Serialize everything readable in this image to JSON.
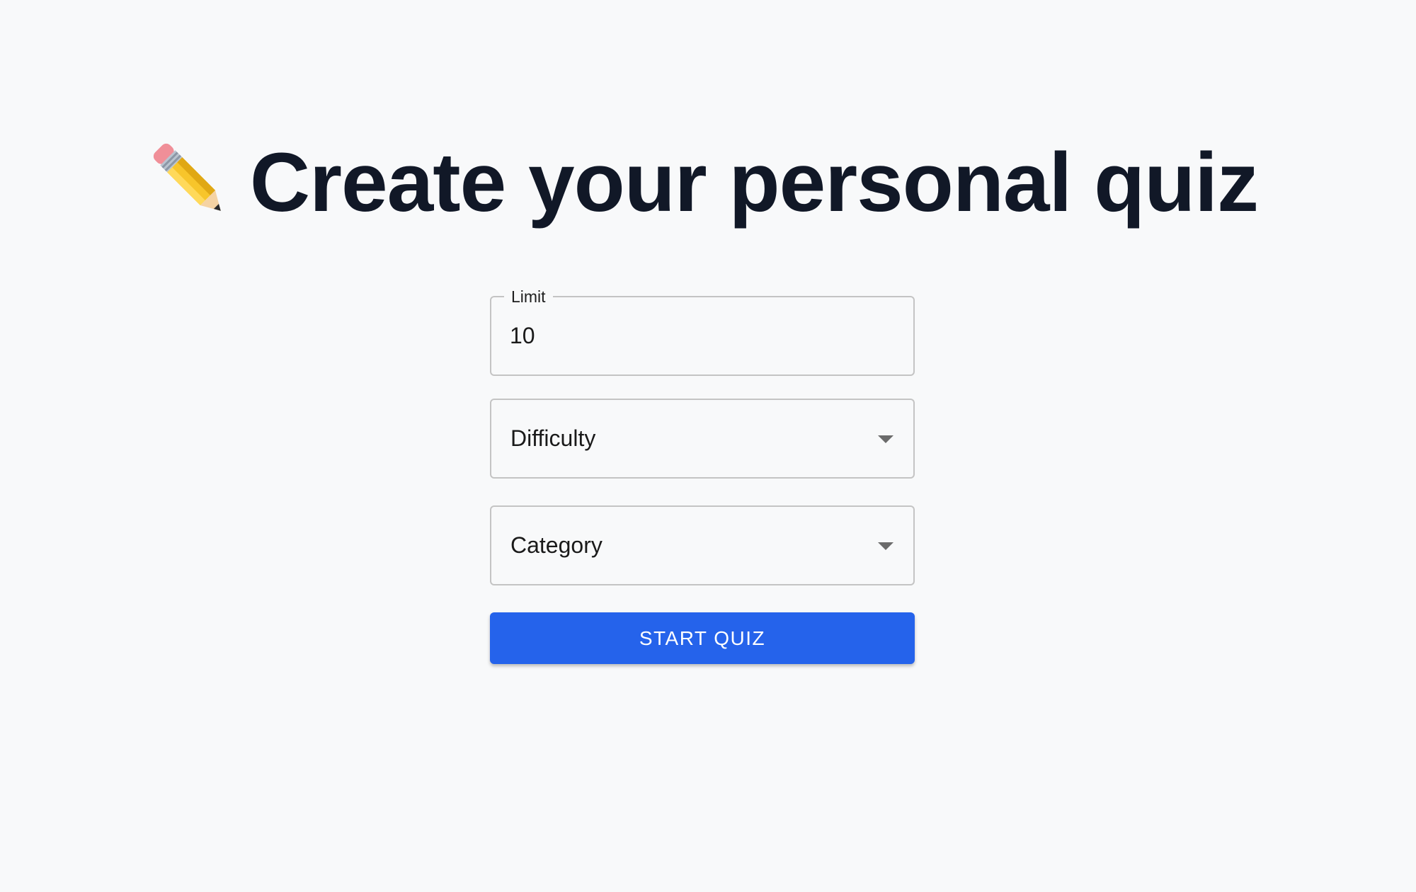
{
  "header": {
    "title": "Create your personal quiz",
    "title_icon": "pencil-icon"
  },
  "form": {
    "limit": {
      "label": "Limit",
      "value": "10"
    },
    "difficulty": {
      "placeholder": "Difficulty",
      "icon": "chevron-down-icon"
    },
    "category": {
      "placeholder": "Category",
      "icon": "chevron-down-icon"
    },
    "start_button_label": "START QUIZ"
  },
  "colors": {
    "background": "#f8f9fa",
    "title_text": "#111827",
    "button": "#2563eb",
    "button_text": "#ffffff",
    "field_border": "#c4c4c4"
  }
}
